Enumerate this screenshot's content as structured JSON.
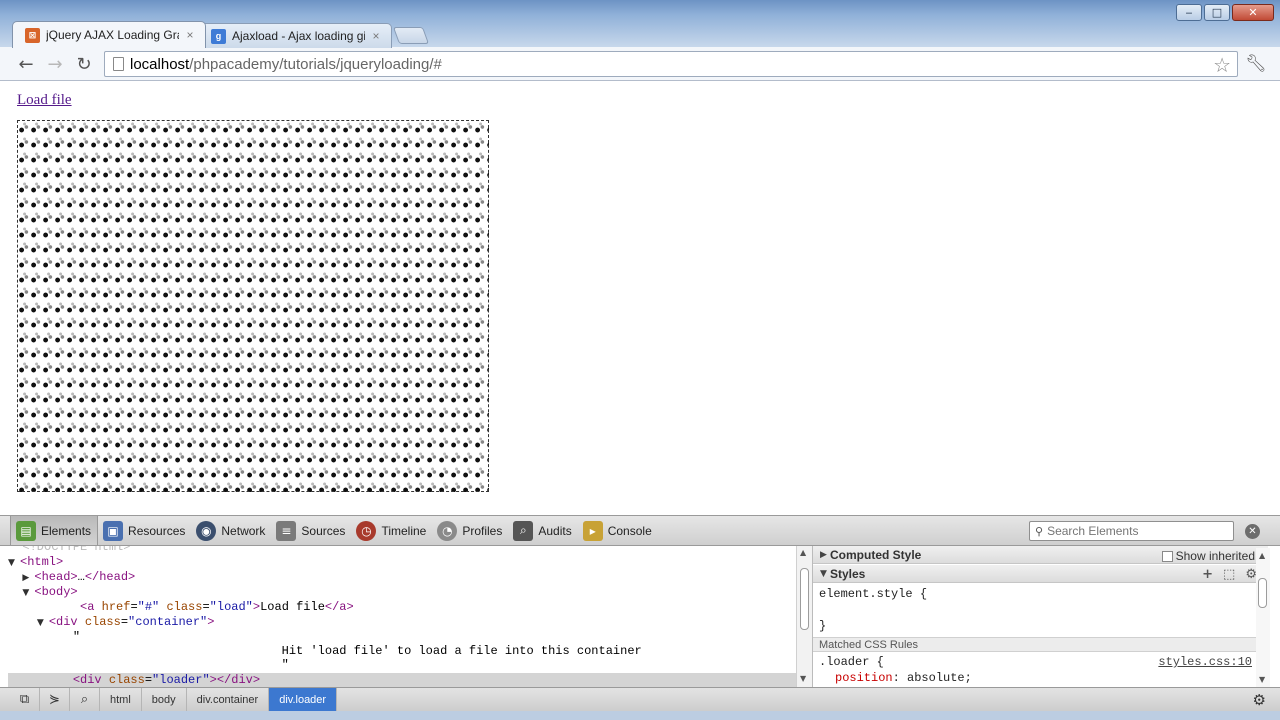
{
  "browser": {
    "tabs": [
      {
        "title": "jQuery AJAX Loading Grapl",
        "favicon": "phpacademy-favicon",
        "active": true
      },
      {
        "title": "Ajaxload - Ajax loading gif",
        "favicon": "google-favicon",
        "active": false
      }
    ],
    "window_controls": {
      "minimize": "‒",
      "maximize": "□",
      "close": "✕"
    },
    "tab_close": "×",
    "url": {
      "host": "localhost",
      "path": "/phpacademy/tutorials/jqueryloading/#"
    }
  },
  "page": {
    "link_text": "Load file"
  },
  "devtools": {
    "tabs": [
      {
        "label": "Elements",
        "icon": "elements-icon",
        "active": true
      },
      {
        "label": "Resources",
        "icon": "resources-icon"
      },
      {
        "label": "Network",
        "icon": "network-icon"
      },
      {
        "label": "Sources",
        "icon": "sources-icon"
      },
      {
        "label": "Timeline",
        "icon": "timeline-icon"
      },
      {
        "label": "Profiles",
        "icon": "profiles-icon"
      },
      {
        "label": "Audits",
        "icon": "audits-icon"
      },
      {
        "label": "Console",
        "icon": "console-icon"
      }
    ],
    "search_placeholder": "Search Elements",
    "dom": {
      "doctype": "<!DOCTYPE html>",
      "html_open": "<html>",
      "head_open": "<head>",
      "head_ellipsis": "…",
      "head_close": "</head>",
      "body_open": "<body>",
      "a_tag_open": "<a",
      "a_href_attr": "href",
      "a_href_val": "\"#\"",
      "a_class_attr": "class",
      "a_class_val": "\"load\"",
      "a_text": "Load file",
      "a_close": "</a>",
      "div_open": "<div",
      "div_class_attr": "class",
      "container_class_val": "\"container\"",
      "tag_gt": ">",
      "quote": "\"",
      "container_text": "Hit 'load file' to load a file into this container",
      "loader_class_val": "\"loader\"",
      "div_close": "</div>"
    },
    "sidebar": {
      "computed_style": "Computed Style",
      "show_inherited": "Show inherited",
      "styles": "Styles",
      "element_style_open": "element.style {",
      "element_style_close": "}",
      "matched_rules": "Matched CSS Rules",
      "loader_rule": ".loader {",
      "rule_source": "styles.css:10",
      "prop_name": "position",
      "prop_value": ": absolute;"
    },
    "breadcrumbs": [
      {
        "label": "html"
      },
      {
        "label": "body"
      },
      {
        "label": "div.container"
      },
      {
        "label": "div.loader",
        "active": true
      }
    ]
  },
  "colors": {
    "link_visited": "#551a8b",
    "breadcrumb_active": "#3c78d0",
    "tag_color": "#881280",
    "attr_color": "#994500",
    "value_color": "#1a1aa6"
  }
}
